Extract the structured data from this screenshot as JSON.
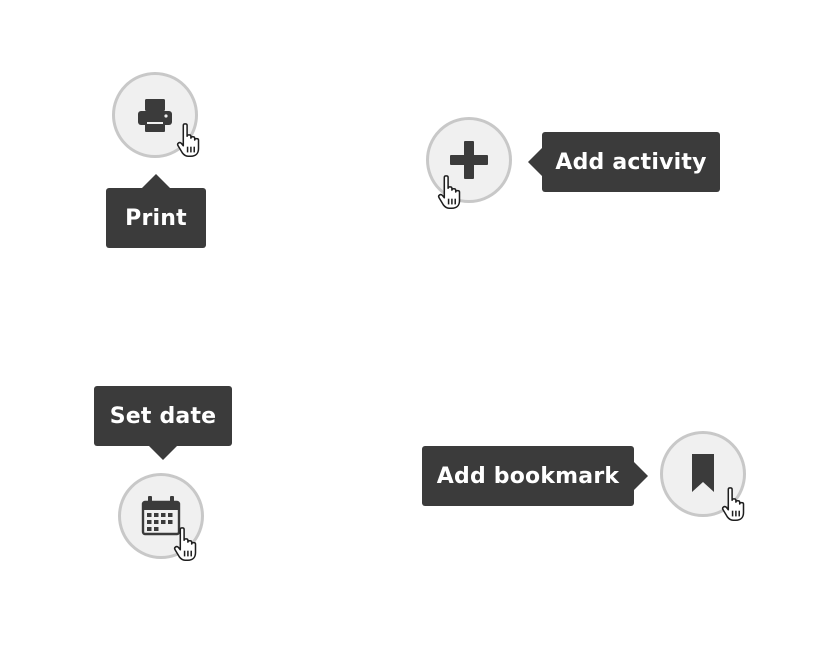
{
  "buttons": {
    "print": {
      "tooltip": "Print",
      "icon": "printer-icon"
    },
    "add_activity": {
      "tooltip": "Add activity",
      "icon": "plus-icon"
    },
    "set_date": {
      "tooltip": "Set date",
      "icon": "calendar-icon"
    },
    "add_bookmark": {
      "tooltip": "Add bookmark",
      "icon": "bookmark-icon"
    }
  },
  "colors": {
    "tooltip_background": "#3b3b3b",
    "tooltip_text": "#ffffff",
    "button_fill": "#f0f0f0",
    "button_border": "#c8c8c8",
    "icon": "#3b3b3b"
  }
}
